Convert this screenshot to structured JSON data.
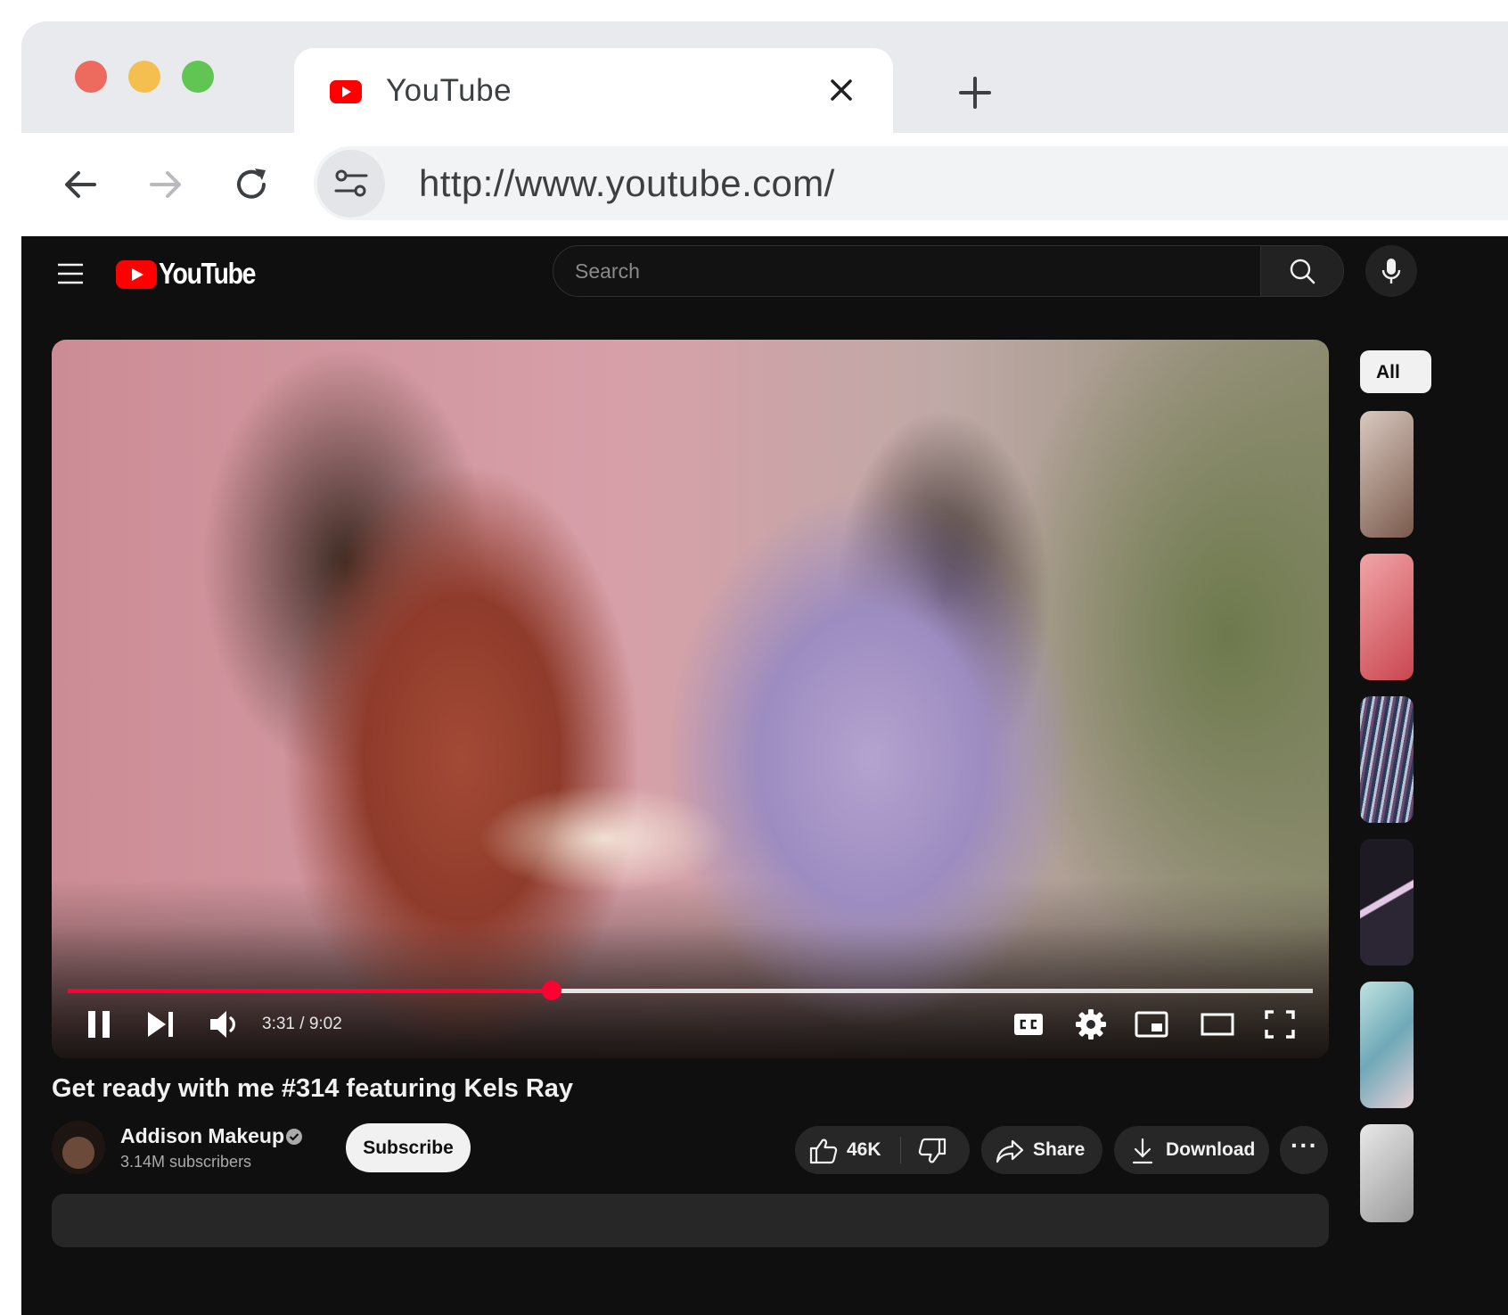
{
  "browser": {
    "tab": {
      "title": "YouTube",
      "favicon": "youtube-favicon-icon"
    },
    "new_tab_icon": "plus-icon",
    "nav": {
      "back": "arrow-left-icon",
      "forward": "arrow-right-icon",
      "reload": "reload-icon"
    },
    "address": {
      "url": "http://www.youtube.com/",
      "site_info_icon": "tune-icon"
    }
  },
  "youtube": {
    "logo_text": "YouTube",
    "search": {
      "placeholder": "Search"
    },
    "player": {
      "time": "3:31 / 9:02",
      "progress_fraction": 0.389,
      "controls": [
        "pause-icon",
        "next-icon",
        "volume-icon",
        "captions-icon",
        "settings-icon",
        "miniplayer-icon",
        "theater-icon",
        "fullscreen-icon"
      ]
    },
    "video": {
      "title": "Get ready with me #314 featuring Kels Ray",
      "channel_name": "Addison Makeup",
      "subscribers": "3.14M subscribers",
      "subscribe_label": "Subscribe",
      "like_count": "46K",
      "share_label": "Share",
      "download_label": "Download",
      "more_label": "···"
    },
    "sidebar": {
      "chip_all": "All"
    }
  },
  "colors": {
    "brand_red": "#ff0000",
    "progress": "#ff0033",
    "page_bg": "#0f0f0f",
    "pill_bg": "#272727"
  }
}
